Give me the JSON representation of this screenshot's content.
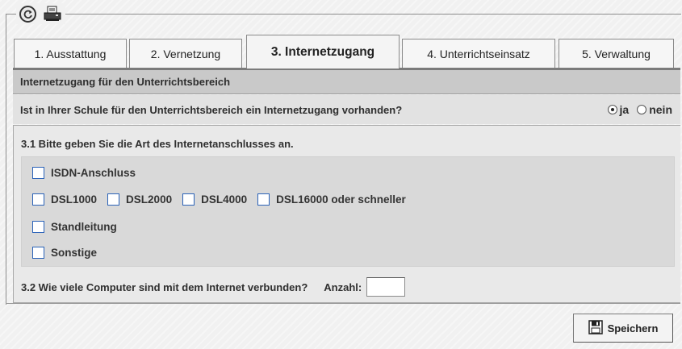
{
  "toolbar": {
    "refresh_icon": "refresh-icon",
    "print_icon": "print-icon"
  },
  "tabs": [
    {
      "label": "1. Ausstattung",
      "active": false
    },
    {
      "label": "2. Vernetzung",
      "active": false
    },
    {
      "label": "3. Internetzugang",
      "active": true
    },
    {
      "label": "4. Unterrichtseinsatz",
      "active": false
    },
    {
      "label": "5. Verwaltung",
      "active": false
    }
  ],
  "section_header": "Internetzugang für den Unterrichtsbereich",
  "question": {
    "text": "Ist in Ihrer Schule für den Unterrichtsbereich ein Internetzugang vorhanden?",
    "options": [
      {
        "label": "ja",
        "checked": true
      },
      {
        "label": "nein",
        "checked": false
      }
    ]
  },
  "section_31": {
    "title": "3.1 Bitte geben Sie die Art des Internetanschlusses an.",
    "options": {
      "isdn": "ISDN-Anschluss",
      "dsl1000": "DSL1000",
      "dsl2000": "DSL2000",
      "dsl4000": "DSL4000",
      "dsl16000": "DSL16000 oder schneller",
      "standleitung": "Standleitung",
      "sonstige": "Sonstige"
    }
  },
  "section_32": {
    "question": "3.2 Wie viele Computer sind mit dem Internet verbunden?",
    "count_label": "Anzahl:",
    "count_value": ""
  },
  "save_button": {
    "label": "Speichern",
    "icon": "save-icon"
  },
  "colors": {
    "checkbox_border": "#2a62b8",
    "header_bg": "#c9c9c9",
    "tab_line": "#7b7b7b"
  }
}
